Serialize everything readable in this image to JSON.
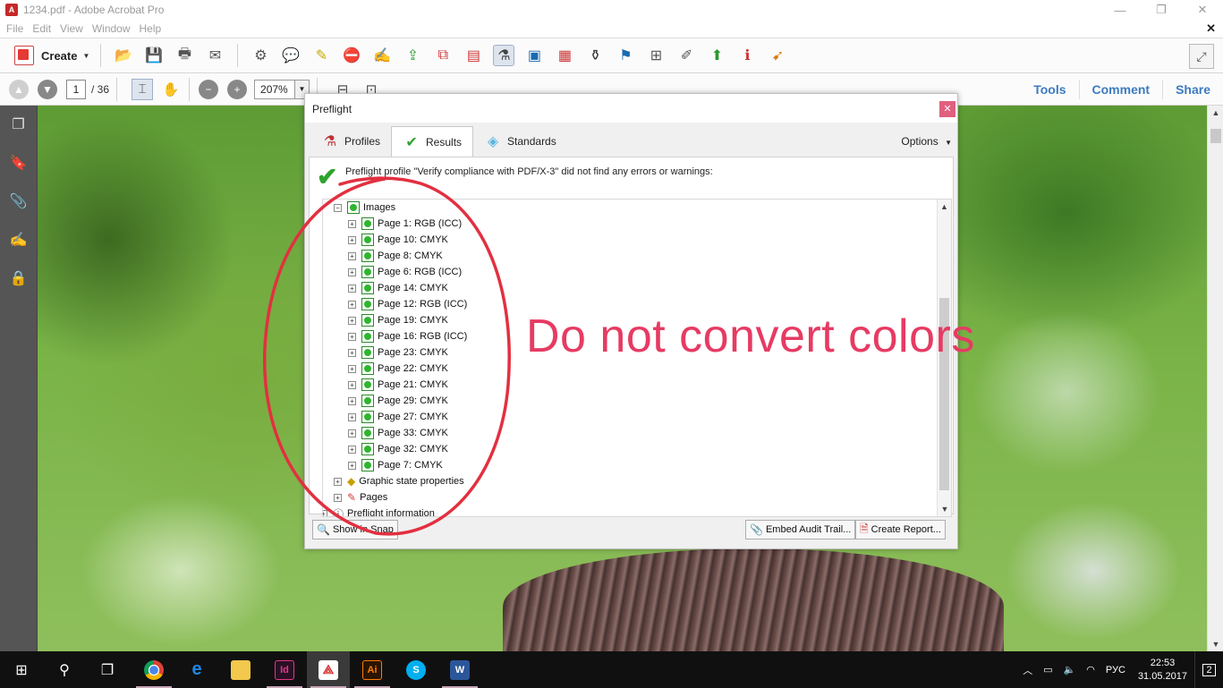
{
  "window": {
    "title": "1234.pdf - Adobe Acrobat Pro",
    "controls": [
      "—",
      "❐",
      "✕"
    ]
  },
  "menu": [
    "File",
    "Edit",
    "View",
    "Window",
    "Help"
  ],
  "toolbar1": {
    "create_label": "Create"
  },
  "toolbar2": {
    "page_number": "1",
    "page_total": "/ 36",
    "zoom": "207%",
    "right_links": [
      "Tools",
      "Comment",
      "Share"
    ]
  },
  "dialog": {
    "title": "Preflight",
    "tabs": [
      "Profiles",
      "Results",
      "Standards"
    ],
    "options_label": "Options",
    "summary_message": "Preflight profile \"Verify compliance with PDF/X-3\" did not find any errors or warnings:",
    "tree": {
      "images_label": "Images",
      "image_items": [
        "Page 1: RGB (ICC)",
        "Page 10: CMYK",
        "Page 8: CMYK",
        "Page 6: RGB (ICC)",
        "Page 14: CMYK",
        "Page 12: RGB (ICC)",
        "Page 19: CMYK",
        "Page 16: RGB (ICC)",
        "Page 23: CMYK",
        "Page 22: CMYK",
        "Page 21: CMYK",
        "Page 29: CMYK",
        "Page 27: CMYK",
        "Page 33: CMYK",
        "Page 32: CMYK",
        "Page 7: CMYK"
      ],
      "graphic_state_label": "Graphic state properties",
      "pages_label": "Pages",
      "preflight_info_label": "Preflight information"
    },
    "buttons": {
      "show_in_snap": "Show in Snap",
      "embed_audit": "Embed Audit Trail...",
      "create_report": "Create Report..."
    }
  },
  "annotation": {
    "text": "Do not convert colors",
    "color": "#e63b63"
  },
  "taskbar": {
    "language": "РУС",
    "time": "22:53",
    "date": "31.05.2017",
    "notifications": "2"
  }
}
